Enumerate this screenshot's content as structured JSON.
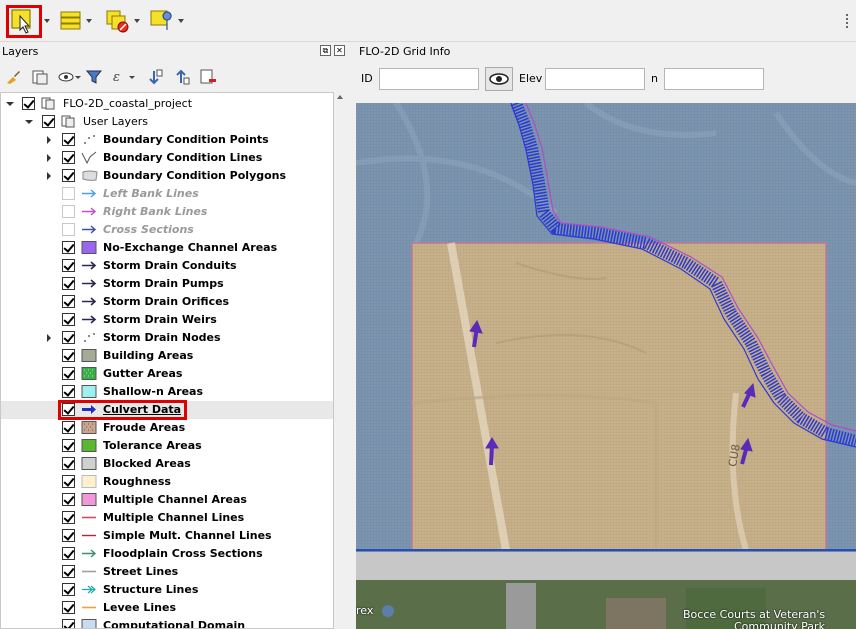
{
  "toolbar": {
    "buttons": [
      "select-features-icon",
      "attribute-table-icon",
      "deselect-features-icon",
      "identify-icon"
    ]
  },
  "layers_panel": {
    "title": "Layers",
    "tools": [
      "style-icon",
      "add-group-icon",
      "visibility-icon",
      "filter-icon",
      "expression-icon",
      "expand-all-icon",
      "collapse-all-icon",
      "remove-layer-icon"
    ],
    "tree": [
      {
        "label": "FLO-2D_coastal_project",
        "type": "project",
        "checked": true,
        "expanded": true
      },
      {
        "label": "User Layers",
        "type": "group",
        "checked": true,
        "expanded": true
      },
      {
        "label": "Boundary Condition Points",
        "symbol": "points",
        "checked": true,
        "expandable": true
      },
      {
        "label": "Boundary Condition Lines",
        "symbol": "lines",
        "checked": true,
        "expandable": true
      },
      {
        "label": "Boundary Condition Polygons",
        "symbol": "polygon-grey",
        "checked": true,
        "expandable": true
      },
      {
        "label": "Left Bank Lines",
        "symbol": "arrow-blue",
        "checked": false,
        "dim": true
      },
      {
        "label": "Right Bank Lines",
        "symbol": "arrow-magenta",
        "checked": false,
        "dim": true
      },
      {
        "label": "Cross Sections",
        "symbol": "arrow-navy",
        "checked": false,
        "dim": true
      },
      {
        "label": "No-Exchange Channel Areas",
        "symbol": "fill-purple",
        "checked": true
      },
      {
        "label": "Storm Drain Conduits",
        "symbol": "arrow-dark",
        "checked": true
      },
      {
        "label": "Storm Drain Pumps",
        "symbol": "arrow-dark",
        "checked": true
      },
      {
        "label": "Storm Drain Orifices",
        "symbol": "arrow-dark",
        "checked": true
      },
      {
        "label": "Storm Drain Weirs",
        "symbol": "arrow-dark",
        "checked": true
      },
      {
        "label": "Storm Drain Nodes",
        "symbol": "points",
        "checked": true,
        "expandable": true
      },
      {
        "label": "Building Areas",
        "symbol": "fill-sage",
        "checked": true
      },
      {
        "label": "Gutter Areas",
        "symbol": "fill-green-dots",
        "checked": true
      },
      {
        "label": "Shallow-n Areas",
        "symbol": "fill-cyan",
        "checked": true
      },
      {
        "label": "Culvert Data",
        "symbol": "arrow-thick-blue",
        "checked": true,
        "selected": true
      },
      {
        "label": "Froude Areas",
        "symbol": "fill-brown-dots",
        "checked": true
      },
      {
        "label": "Tolerance Areas",
        "symbol": "fill-green",
        "checked": true
      },
      {
        "label": "Blocked Areas",
        "symbol": "fill-lightgrey",
        "checked": true
      },
      {
        "label": "Roughness",
        "symbol": "fill-cream",
        "checked": true
      },
      {
        "label": "Multiple Channel Areas",
        "symbol": "fill-pink",
        "checked": true
      },
      {
        "label": "Multiple Channel Lines",
        "symbol": "line-red",
        "checked": true
      },
      {
        "label": "Simple Mult. Channel Lines",
        "symbol": "line-crimson",
        "checked": true
      },
      {
        "label": "Floodplain Cross Sections",
        "symbol": "arrow-teal",
        "checked": true
      },
      {
        "label": "Street Lines",
        "symbol": "line-grey",
        "checked": true
      },
      {
        "label": "Structure Lines",
        "symbol": "arrow-cyan",
        "checked": true
      },
      {
        "label": "Levee Lines",
        "symbol": "line-orange",
        "checked": true
      },
      {
        "label": "Computational Domain",
        "symbol": "fill-paleblue",
        "checked": true
      }
    ]
  },
  "grid_info": {
    "title": "FLO-2D Grid Info",
    "id_label": "ID",
    "id_value": "",
    "elev_label": "Elev",
    "elev_value": "",
    "n_label": "n",
    "n_value": ""
  },
  "map": {
    "labels": [
      "CU8",
      "rex",
      "Bocce Courts at Veteran's",
      "Community Park"
    ],
    "colors": {
      "grid": "#4a7fb0",
      "domain": "#d8bf96",
      "domain_border": "#c07898",
      "channel_arrows": "#2a39d6",
      "domain_line": "#1f4fc8",
      "culvert_arrow": "#5a2ab8"
    }
  }
}
